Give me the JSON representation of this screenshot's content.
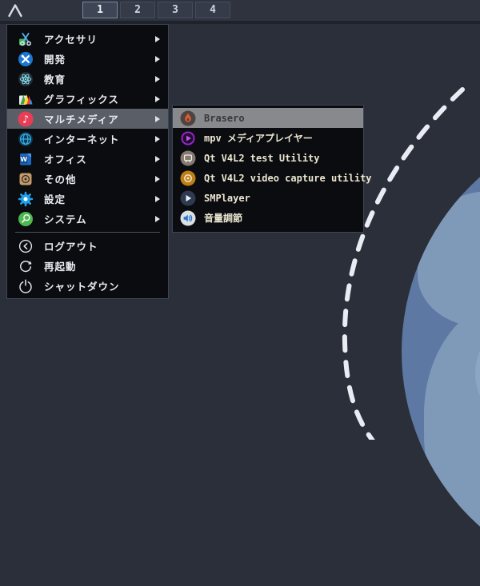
{
  "topbar": {
    "logo_icon": "arcolinux-logo",
    "workspaces": [
      {
        "label": "1",
        "active": true
      },
      {
        "label": "2",
        "active": false
      },
      {
        "label": "3",
        "active": false
      },
      {
        "label": "4",
        "active": false
      }
    ]
  },
  "menu": {
    "categories": [
      {
        "label": "アクセサリ",
        "icon": "scissors-icon",
        "has_submenu": true
      },
      {
        "label": "開発",
        "icon": "dev-tools-icon",
        "has_submenu": true
      },
      {
        "label": "教育",
        "icon": "atom-icon",
        "has_submenu": true
      },
      {
        "label": "グラフィックス",
        "icon": "graphics-triangles-icon",
        "has_submenu": true
      },
      {
        "label": "マルチメディア",
        "icon": "music-note-icon",
        "has_submenu": true,
        "highlighted": true
      },
      {
        "label": "インターネット",
        "icon": "globe-icon",
        "has_submenu": true
      },
      {
        "label": "オフィス",
        "icon": "word-document-icon",
        "has_submenu": true
      },
      {
        "label": "その他",
        "icon": "package-icon",
        "has_submenu": true
      },
      {
        "label": "設定",
        "icon": "gear-icon",
        "has_submenu": true
      },
      {
        "label": "システム",
        "icon": "magnifier-icon",
        "has_submenu": true
      }
    ],
    "actions": [
      {
        "label": "ログアウト",
        "icon": "logout-icon"
      },
      {
        "label": "再起動",
        "icon": "restart-icon"
      },
      {
        "label": "シャットダウン",
        "icon": "power-icon"
      }
    ]
  },
  "submenu": {
    "items": [
      {
        "label": "Brasero",
        "icon": "brasero-flame-icon",
        "highlighted": true
      },
      {
        "label": "mpv メディアプレイヤー",
        "icon": "mpv-play-icon"
      },
      {
        "label": "Qt V4L2 test Utility",
        "icon": "tv-icon"
      },
      {
        "label": "Qt V4L2 video capture utility",
        "icon": "camera-reel-icon"
      },
      {
        "label": "SMPlayer",
        "icon": "play-icon"
      },
      {
        "label": "音量調節",
        "icon": "speaker-icon"
      }
    ]
  },
  "glyphs": {
    "music_note": "♪",
    "office_w": "W"
  },
  "colors": {
    "desktop": "#2a2f39",
    "topbar": "#2e333e",
    "menu_bg": "#0a0c0f",
    "highlight_main": "#5a5e66",
    "highlight_sub": "#87898d",
    "menu_text": "#e8ebf0",
    "submenu_text": "#ece5d1",
    "planet": "#5d79a3",
    "land": "#7f99b9",
    "orbit": "#e9edf3"
  }
}
